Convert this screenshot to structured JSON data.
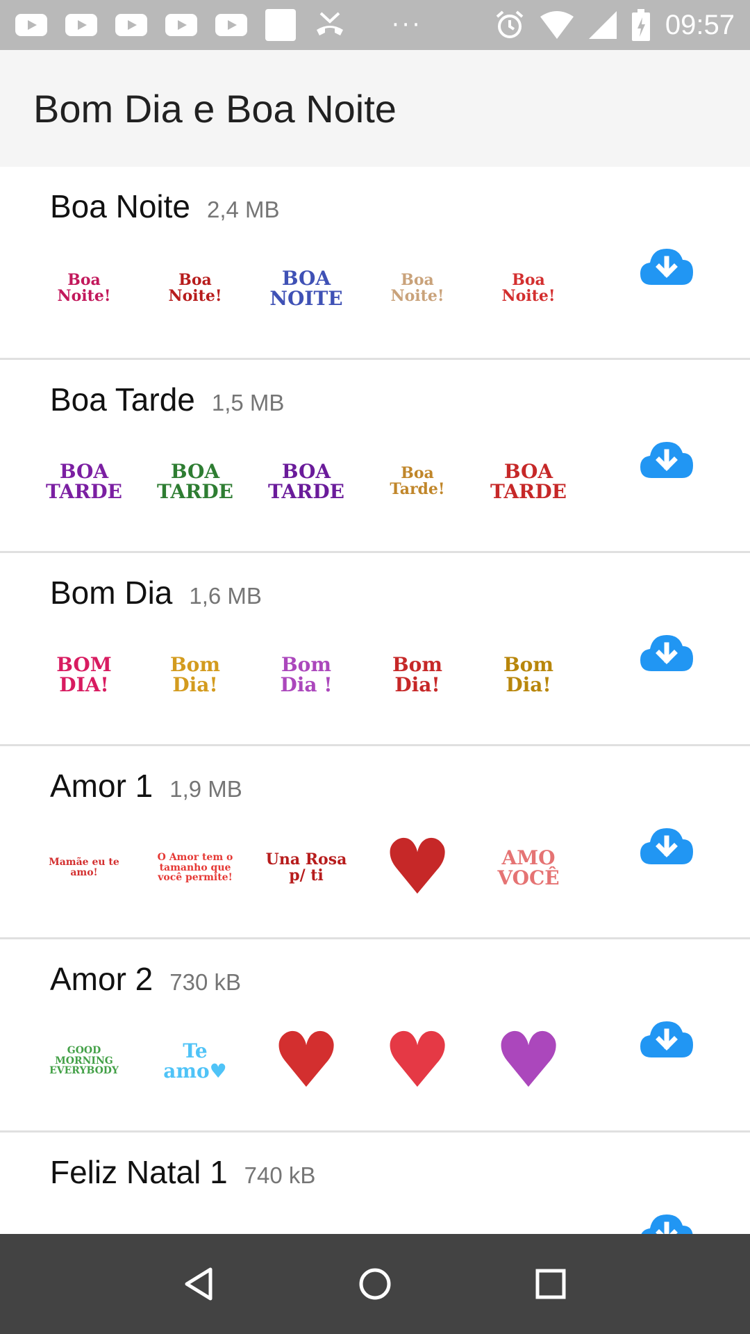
{
  "status_bar": {
    "time": "09:57",
    "left_icons": [
      "youtube-icon",
      "youtube-icon",
      "youtube-icon",
      "youtube-icon",
      "youtube-icon",
      "document-icon",
      "missed-call-icon"
    ],
    "more": "···"
  },
  "app_bar": {
    "title": "Bom Dia e Boa Noite"
  },
  "accent_color": "#2196f3",
  "packs": [
    {
      "name": "Boa Noite",
      "size": "2,4 MB",
      "stickers": [
        {
          "text": "Boa Noite!",
          "color": "#c2185b"
        },
        {
          "text": "Boa Noite!",
          "color": "#b71c1c"
        },
        {
          "text": "BOA NOITE",
          "color": "#3f51b5"
        },
        {
          "text": "Boa Noite!",
          "color": "#c9a27a"
        },
        {
          "text": "Boa Noite!",
          "color": "#d32f2f"
        }
      ]
    },
    {
      "name": "Boa Tarde",
      "size": "1,5 MB",
      "stickers": [
        {
          "text": "BOA TARDE",
          "color": "#7b1fa2"
        },
        {
          "text": "BOA TARDE",
          "color": "#2e7d32"
        },
        {
          "text": "BOA TARDE",
          "color": "#6a1b9a"
        },
        {
          "text": "Boa Tarde!",
          "color": "#c0862a"
        },
        {
          "text": "BOA TARDE",
          "color": "#c62828"
        }
      ]
    },
    {
      "name": "Bom Dia",
      "size": "1,6 MB",
      "stickers": [
        {
          "text": "BOM DIA!",
          "color": "#d81b60"
        },
        {
          "text": "Bom Dia!",
          "color": "#d39b1e"
        },
        {
          "text": "Bom Dia !",
          "color": "#ab47bc"
        },
        {
          "text": "Bom Dia!",
          "color": "#c62828"
        },
        {
          "text": "Bom Dia!",
          "color": "#b8860b"
        }
      ]
    },
    {
      "name": "Amor 1",
      "size": "1,9 MB",
      "stickers": [
        {
          "text": "Mamãe eu te amo!",
          "color": "#d32f2f"
        },
        {
          "text": "O Amor tem o tamanho que você permite!",
          "color": "#e53935"
        },
        {
          "text": "Una Rosa p/ ti",
          "color": "#b71c1c"
        },
        {
          "text": "♥",
          "color": "#c62828"
        },
        {
          "text": "AMO VOCÊ",
          "color": "#e57373"
        }
      ]
    },
    {
      "name": "Amor 2",
      "size": "730 kB",
      "stickers": [
        {
          "text": "GOOD MORNING EVERYBODY",
          "color": "#43a047"
        },
        {
          "text": "Te amo♥",
          "color": "#4fc3f7"
        },
        {
          "text": "♥",
          "color": "#d32f2f"
        },
        {
          "text": "♥",
          "color": "#e53945"
        },
        {
          "text": "♥",
          "color": "#ab47bc"
        }
      ]
    },
    {
      "name": "Feliz Natal 1",
      "size": "740 kB",
      "stickers": [
        {
          "text": "",
          "color": "#9e9e9e"
        },
        {
          "text": "",
          "color": "#9e9e9e"
        },
        {
          "text": "",
          "color": "#c62828"
        },
        {
          "text": "",
          "color": "#e57373"
        },
        {
          "text": "",
          "color": "#66bb6a"
        }
      ]
    }
  ],
  "nav_bar": {
    "buttons": [
      "back-icon",
      "home-icon",
      "recents-icon"
    ]
  }
}
